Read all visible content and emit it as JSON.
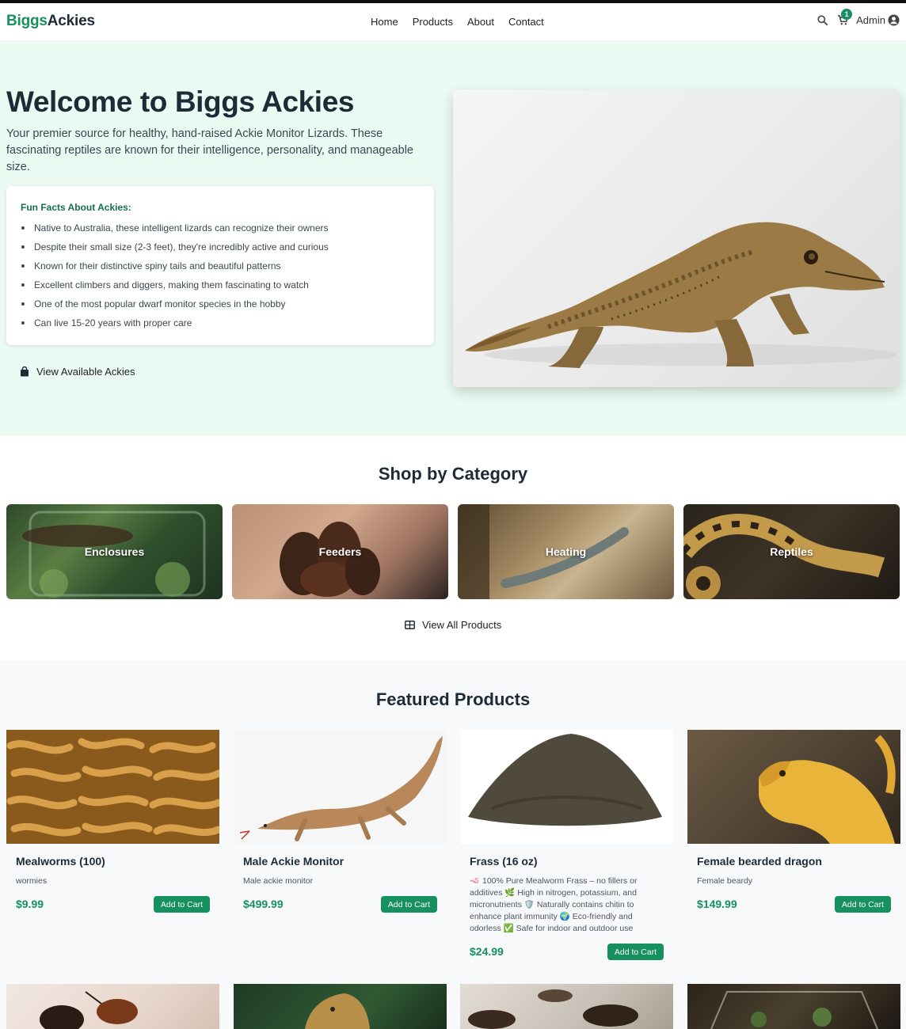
{
  "navbar": {
    "brand_part1": "Biggs",
    "brand_part2": "Ackies",
    "links": [
      "Home",
      "Products",
      "About",
      "Contact"
    ],
    "cart_count": "1",
    "admin_label": "Admin",
    "icons": [
      "search-icon",
      "cart-icon",
      "user-circle-icon"
    ]
  },
  "hero": {
    "title": "Welcome to Biggs Ackies",
    "text": "Your premier source for healthy, hand-raised Ackie Monitor Lizards. These fascinating reptiles are known for their intelligence, personality, and manageable size.",
    "facts_title": "Fun Facts About Ackies:",
    "facts": [
      "Native to Australia, these intelligent lizards can recognize their owners",
      "Despite their small size (2-3 feet), they're incredibly active and curious",
      "Known for their distinctive spiny tails and beautiful patterns",
      "Excellent climbers and diggers, making them fascinating to watch",
      "One of the most popular dwarf monitor species in the hobby",
      "Can live 15-20 years with proper care"
    ],
    "cta_label": "View Available Ackies",
    "cta_icon": "shopping-bag-icon"
  },
  "categories": {
    "title": "Shop by Category",
    "items": [
      "Enclosures",
      "Feeders",
      "Heating",
      "Reptiles"
    ],
    "view_all_label": "View All Products",
    "view_all_icon": "grid-icon"
  },
  "featured": {
    "title": "Featured Products",
    "products": [
      {
        "name": "Mealworms (100)",
        "desc": "wormies",
        "price": "$9.99",
        "button": "Add to Cart"
      },
      {
        "name": "Male Ackie Monitor",
        "desc": "Male ackie monitor",
        "price": "$499.99",
        "button": "Add to Cart"
      },
      {
        "name": "Frass (16 oz)",
        "desc": "🪱 100% Pure Mealworm Frass – no fillers or additives 🌿 High in nitrogen, potassium, and micronutrients 🛡️ Naturally contains chitin to enhance plant immunity 🌍 Eco-friendly and odorless ✅ Safe for indoor and outdoor use",
        "price": "$24.99",
        "button": "Add to Cart"
      },
      {
        "name": "Female bearded dragon",
        "desc": "Female beardy",
        "price": "$149.99",
        "button": "Add to Cart"
      }
    ]
  },
  "colors": {
    "accent": "#15905e",
    "hero_bg": "#ebfbf3",
    "featured_bg": "#f7f9fa"
  }
}
